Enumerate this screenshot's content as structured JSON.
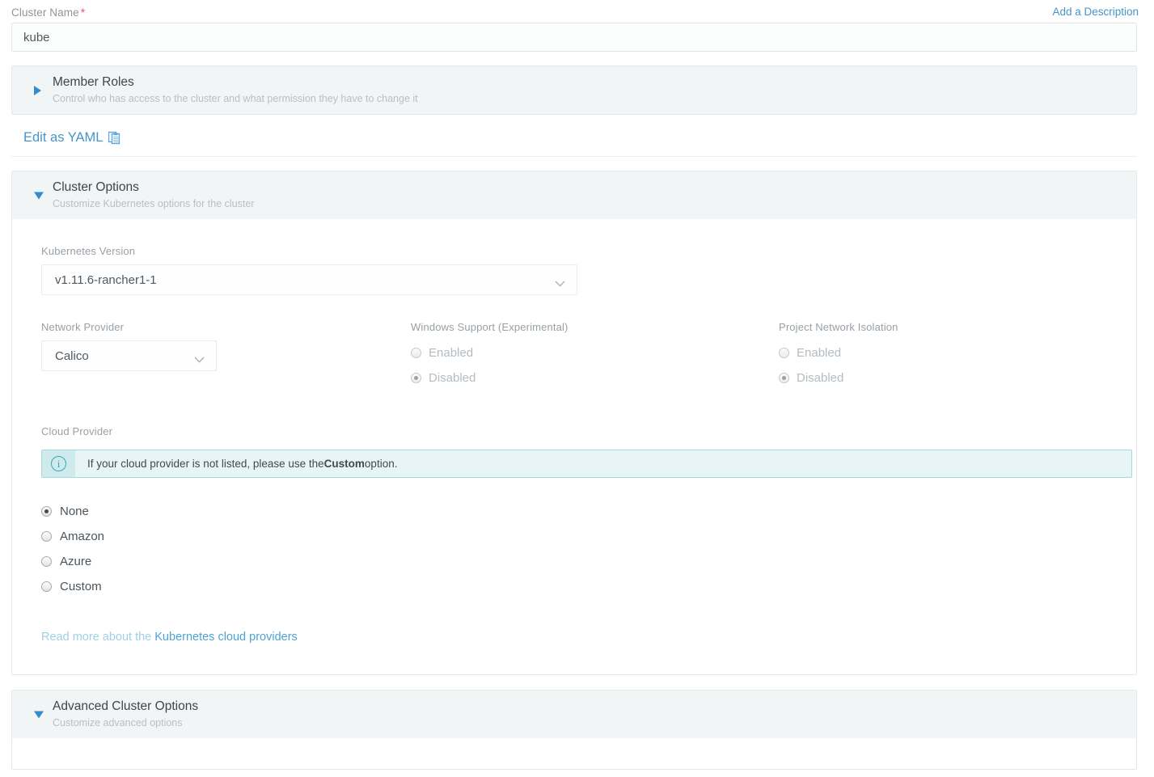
{
  "cluster_name": {
    "label": "Cluster Name",
    "required_marker": "*",
    "value": "kube",
    "add_description_link": "Add a Description"
  },
  "member_roles": {
    "title": "Member Roles",
    "subtitle": "Control who has access to the cluster and what permission they have to change it",
    "expanded": false,
    "caret_icon": "caret-right-icon"
  },
  "yaml": {
    "link_label": "Edit as YAML",
    "icon": "clipboard-icon"
  },
  "cluster_options": {
    "title": "Cluster Options",
    "subtitle": "Customize Kubernetes options for the cluster",
    "expanded": true,
    "caret_icon": "caret-down-icon",
    "kubernetes_version": {
      "label": "Kubernetes Version",
      "value": "v1.11.6-rancher1-1",
      "chevron_icon": "chevron-down-icon"
    },
    "network_provider": {
      "label": "Network Provider",
      "value": "Calico",
      "chevron_icon": "chevron-down-icon"
    },
    "windows_support": {
      "label": "Windows Support (Experimental)",
      "disabled": true,
      "options": [
        {
          "label": "Enabled",
          "selected": false
        },
        {
          "label": "Disabled",
          "selected": true
        }
      ]
    },
    "project_network_isolation": {
      "label": "Project Network Isolation",
      "disabled": true,
      "options": [
        {
          "label": "Enabled",
          "selected": false
        },
        {
          "label": "Disabled",
          "selected": true
        }
      ]
    },
    "cloud_provider": {
      "label": "Cloud Provider",
      "banner": {
        "icon": "info-icon",
        "text_before": "If your cloud provider is not listed, please use the ",
        "text_bold": "Custom",
        "text_after": " option."
      },
      "options": [
        {
          "label": "None",
          "selected": true
        },
        {
          "label": "Amazon",
          "selected": false
        },
        {
          "label": "Azure",
          "selected": false
        },
        {
          "label": "Custom",
          "selected": false
        }
      ],
      "read_more_prefix": "Read more about the ",
      "read_more_link": "Kubernetes cloud providers"
    }
  },
  "advanced_cluster_options": {
    "title": "Advanced Cluster Options",
    "subtitle": "Customize advanced options",
    "expanded": true,
    "caret_icon": "caret-down-icon"
  },
  "colors": {
    "link": "#4695c8",
    "accent": "#2f8ed2",
    "required": "#e8576e",
    "banner_bg": "#e7f5f6",
    "banner_border": "#a4d9de",
    "banner_icon_bg": "#cfeaec",
    "banner_icon": "#3aa5ae",
    "header_bg": "#f1f5f6"
  }
}
